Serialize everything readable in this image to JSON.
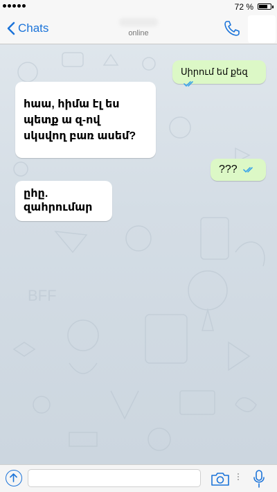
{
  "status_bar": {
    "battery_percent": "72 %",
    "battery_level": 0.72,
    "signal_dots": 5
  },
  "header": {
    "back_label": "Chats",
    "contact_status": "online",
    "back_icon": "chevron-left-icon",
    "call_icon": "phone-icon"
  },
  "messages": [
    {
      "direction": "out",
      "text": "Սիրում եմ քեզ",
      "read": true
    },
    {
      "direction": "in",
      "lines": [
        "հաա, հիմա էլ ես",
        "պետք ա զ-ով",
        "սկսվող բառ ասեմ?"
      ]
    },
    {
      "direction": "out",
      "text": "???",
      "read": true
    },
    {
      "direction": "in",
      "lines": [
        "ըհը.",
        "զահրումար"
      ]
    }
  ],
  "input_bar": {
    "placeholder": "",
    "attach_icon": "arrow-up-circle-icon",
    "camera_icon": "camera-icon",
    "mic_icon": "microphone-icon"
  },
  "colors": {
    "accent": "#1a73d9",
    "outgoing_bubble": "#dcf8c6",
    "incoming_bubble": "#ffffff",
    "read_ticks": "#3ba4e8"
  }
}
